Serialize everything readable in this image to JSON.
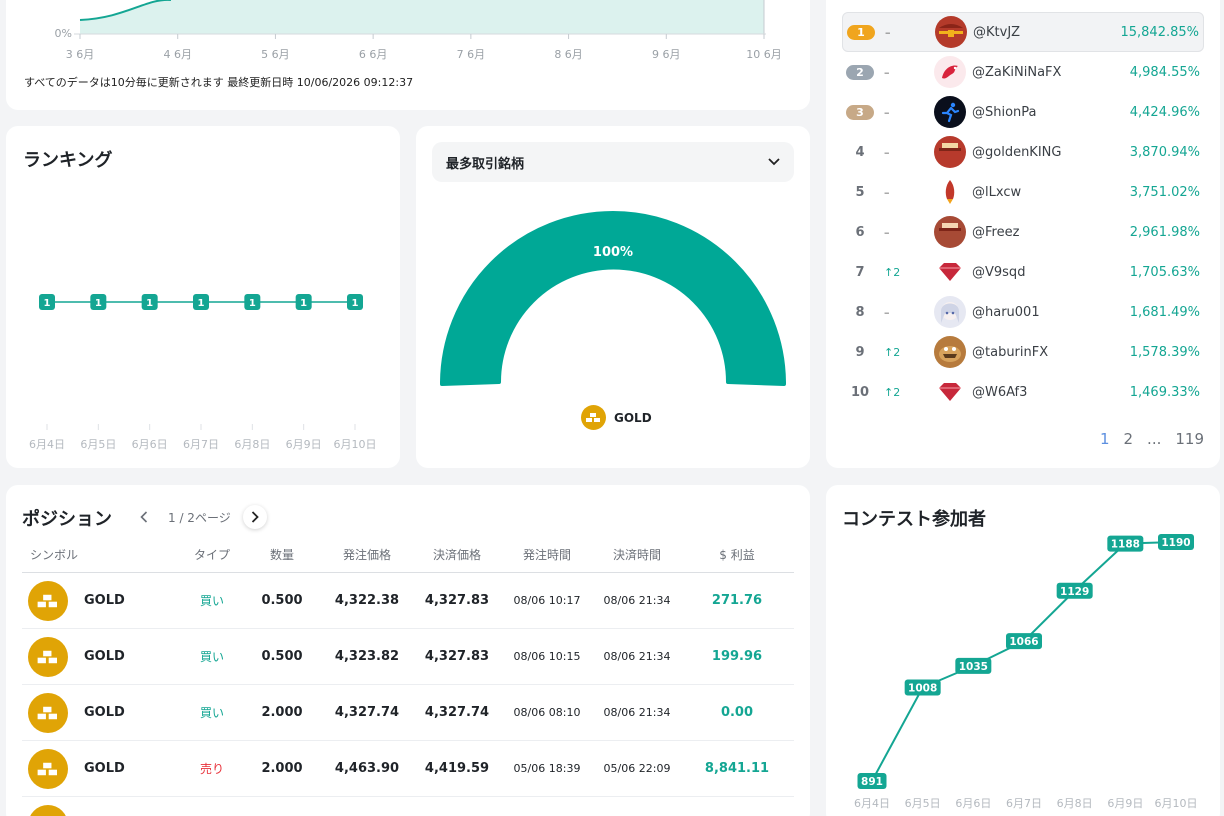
{
  "performance_chart": {
    "y_tick": "0%",
    "x_ticks": [
      "3 6月",
      "4 6月",
      "5 6月",
      "6 6月",
      "7 6月",
      "8 6月",
      "9 6月",
      "10 6月"
    ],
    "footnote": "すべてのデータは10分毎に更新されます 最終更新日時 10/06/2026 09:12:37"
  },
  "ranking": {
    "title": "ランキング",
    "chart_data": {
      "type": "line",
      "categories": [
        "6月4日",
        "6月5日",
        "6月6日",
        "6月7日",
        "6月8日",
        "6月9日",
        "6月10日"
      ],
      "values": [
        1,
        1,
        1,
        1,
        1,
        1,
        1
      ]
    }
  },
  "most_traded": {
    "dropdown_label": "最多取引銘柄",
    "chart_data": {
      "type": "pie",
      "labels": [
        "GOLD"
      ],
      "values": [
        100
      ],
      "value_label": "100%"
    },
    "legend_label": "GOLD",
    "colors": {
      "gauge": "#00a896",
      "coin": "#e0a406"
    }
  },
  "leaderboard": {
    "rows": [
      {
        "rank": "1",
        "change": "–",
        "name": "@KtvJZ",
        "pct": "15,842.85%",
        "avatar": "treasure-chest-icon"
      },
      {
        "rank": "2",
        "change": "–",
        "name": "@ZaKiNiNaFX",
        "pct": "4,984.55%",
        "avatar": "dragon-icon"
      },
      {
        "rank": "3",
        "change": "–",
        "name": "@ShionPa",
        "pct": "4,424.96%",
        "avatar": "runner-icon"
      },
      {
        "rank": "4",
        "change": "–",
        "name": "@goldenKING",
        "pct": "3,870.94%",
        "avatar": "cash-stack-icon"
      },
      {
        "rank": "5",
        "change": "–",
        "name": "@lLxcw",
        "pct": "3,751.02%",
        "avatar": "rocket-icon"
      },
      {
        "rank": "6",
        "change": "–",
        "name": "@Freez",
        "pct": "2,961.98%",
        "avatar": "cash-box-icon"
      },
      {
        "rank": "7",
        "change": "2",
        "name": "@V9sqd",
        "pct": "1,705.63%",
        "avatar": "ruby-icon"
      },
      {
        "rank": "8",
        "change": "–",
        "name": "@haru001",
        "pct": "1,681.49%",
        "avatar": "anime-girl-icon"
      },
      {
        "rank": "9",
        "change": "2",
        "name": "@taburinFX",
        "pct": "1,578.39%",
        "avatar": "creature-icon"
      },
      {
        "rank": "10",
        "change": "2",
        "name": "@W6Af3",
        "pct": "1,469.33%",
        "avatar": "ruby-icon"
      }
    ],
    "pager": [
      "1",
      "2",
      "...",
      "119"
    ],
    "colors": {
      "gold": "#f0a51e",
      "silver": "#9ba6b1",
      "bronze": "#c7a987"
    }
  },
  "positions": {
    "title": "ポジション",
    "page_label": "1 / 2ページ",
    "headers": [
      "シンボル",
      "タイプ",
      "数量",
      "発注価格",
      "決済価格",
      "発注時間",
      "決済時間",
      "$ 利益"
    ],
    "rows": [
      {
        "symbol": "GOLD",
        "type": "買い",
        "qty": "0.500",
        "open": "4,322.38",
        "close": "4,327.83",
        "open_time": "08/06 10:17",
        "close_time": "08/06 21:34",
        "profit": "271.76"
      },
      {
        "symbol": "GOLD",
        "type": "買い",
        "qty": "0.500",
        "open": "4,323.82",
        "close": "4,327.83",
        "open_time": "08/06 10:15",
        "close_time": "08/06 21:34",
        "profit": "199.96"
      },
      {
        "symbol": "GOLD",
        "type": "買い",
        "qty": "2.000",
        "open": "4,327.74",
        "close": "4,327.74",
        "open_time": "08/06 08:10",
        "close_time": "08/06 21:34",
        "profit": "0.00"
      },
      {
        "symbol": "GOLD",
        "type": "売り",
        "qty": "2.000",
        "open": "4,463.90",
        "close": "4,419.59",
        "open_time": "05/06 18:39",
        "close_time": "05/06 22:09",
        "profit": "8,841.11"
      }
    ]
  },
  "participants": {
    "title": "コンテスト参加者",
    "chart_data": {
      "type": "line",
      "categories": [
        "6月4日",
        "6月5日",
        "6月6日",
        "6月7日",
        "6月8日",
        "6月9日",
        "6月10日"
      ],
      "values": [
        891,
        1008,
        1035,
        1066,
        1129,
        1188,
        1190
      ]
    }
  }
}
